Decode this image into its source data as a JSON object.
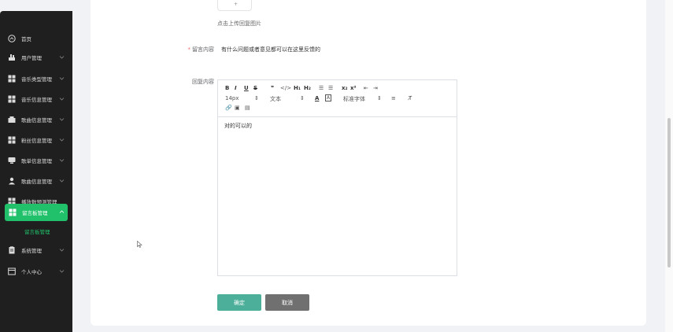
{
  "sidebar": {
    "items": [
      {
        "label": "首页",
        "icon": "home-icon"
      },
      {
        "label": "用户管理",
        "icon": "user-manage-icon"
      },
      {
        "label": "音乐类型管理",
        "icon": "grid-icon"
      },
      {
        "label": "音乐信息管理",
        "icon": "grid-icon"
      },
      {
        "label": "歌曲信息管理",
        "icon": "folder-icon"
      },
      {
        "label": "粉丝信息管理",
        "icon": "grid-icon"
      },
      {
        "label": "歌单信息管理",
        "icon": "monitor-icon"
      },
      {
        "label": "歌曲信息管理",
        "icon": "person-icon"
      },
      {
        "label": "播放数预测管理",
        "icon": "grid-icon"
      },
      {
        "label": "留言板管理",
        "icon": "grid-icon"
      },
      {
        "label": "系统管理",
        "icon": "doc-icon"
      },
      {
        "label": "个人中心",
        "icon": "window-icon"
      }
    ],
    "submenu_label": "留言板管理",
    "accent_color": "#20c16a"
  },
  "form": {
    "upload_stub_text": "+",
    "upload_hint": "点击上传回复图片",
    "message_label": "留言内容",
    "message_value": "有什么问题或者意见都可以在这里反馈的",
    "reply_label": "回复内容",
    "editor": {
      "font_size": "14px",
      "text_style": "文本",
      "font_family": "标准字体",
      "content": "对的可以的"
    },
    "confirm_label": "确定",
    "cancel_label": "取消"
  }
}
